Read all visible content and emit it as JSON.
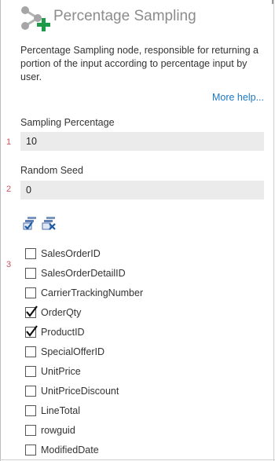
{
  "panel": {
    "title": "Percentage Sampling",
    "title_icon": "sampling-node-add-icon",
    "description": "Percentage Sampling node, responsible for returning a portion of the input according to percentage input by user.",
    "more_help": "More help..."
  },
  "fields": {
    "sampling_percentage": {
      "number": "1",
      "label": "Sampling Percentage",
      "value": "10"
    },
    "random_seed": {
      "number": "2",
      "label": "Random Seed",
      "value": "0"
    }
  },
  "columns": {
    "number": "3",
    "toolbar": {
      "select_all_icon": "select-all-icon",
      "clear_all_icon": "clear-selection-icon"
    },
    "items": [
      {
        "label": "SalesOrderID",
        "checked": false
      },
      {
        "label": "SalesOrderDetailID",
        "checked": false
      },
      {
        "label": "CarrierTrackingNumber",
        "checked": false
      },
      {
        "label": "OrderQty",
        "checked": true
      },
      {
        "label": "ProductID",
        "checked": true
      },
      {
        "label": "SpecialOfferID",
        "checked": false
      },
      {
        "label": "UnitPrice",
        "checked": false
      },
      {
        "label": "UnitPriceDiscount",
        "checked": false
      },
      {
        "label": "LineTotal",
        "checked": false
      },
      {
        "label": "rowguid",
        "checked": false
      },
      {
        "label": "ModifiedDate",
        "checked": false
      }
    ]
  },
  "colors": {
    "accent_link": "#1b78c4",
    "plus_green": "#1e9a4a",
    "row_number": "#d05060",
    "field_bg": "#ebebeb"
  }
}
